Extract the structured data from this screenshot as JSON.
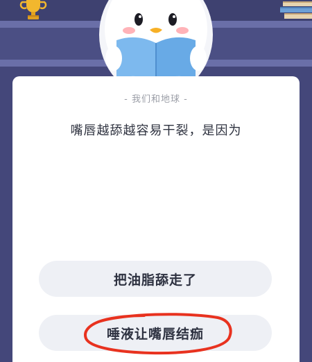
{
  "quiz": {
    "category": "- 我们和地球 -",
    "question": "嘴唇越舔越容易干裂，是因为",
    "options": [
      {
        "label": "把油脂舔走了"
      },
      {
        "label": "唾液让嘴唇结痂"
      }
    ]
  },
  "colors": {
    "background": "#4a4d7e",
    "card": "#ffffff",
    "option_bg": "#eef0f5",
    "annotation": "#e8321f",
    "book": "#6aaee8"
  },
  "icons": {
    "mascot": "penguin-reading-icon",
    "trophy": "trophy-icon",
    "books": "books-icon"
  }
}
